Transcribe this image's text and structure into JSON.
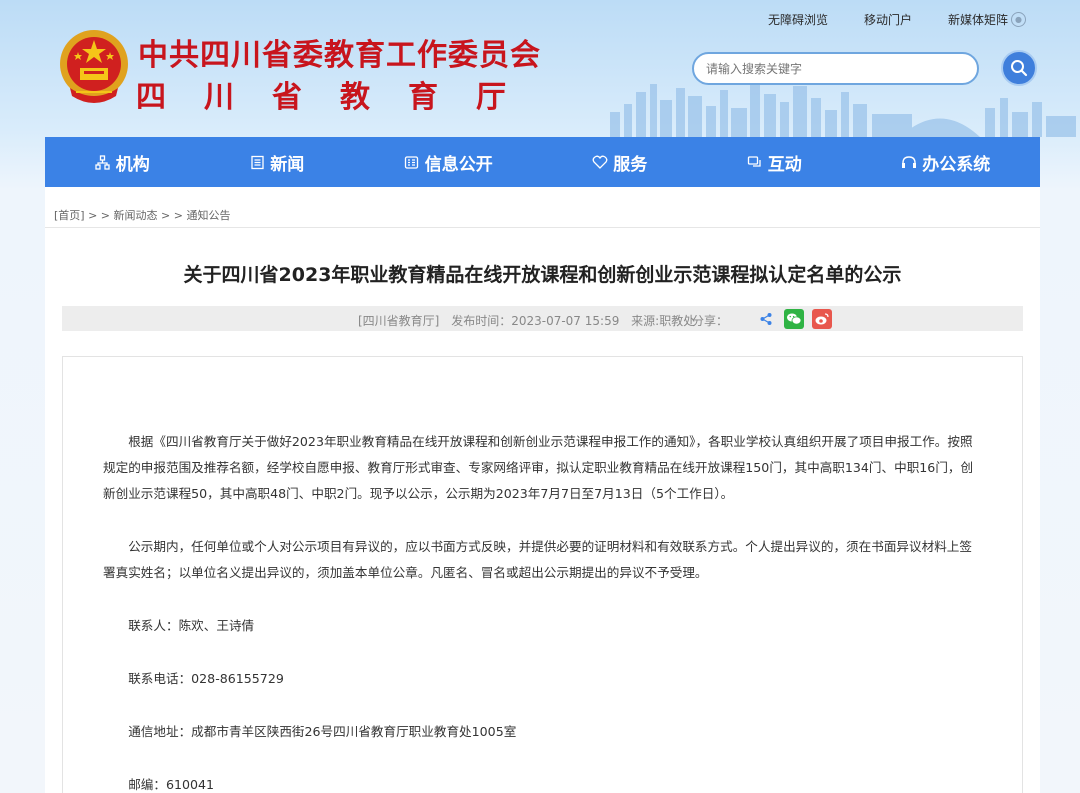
{
  "header": {
    "org_name": "中共四川省委教育工作委员会",
    "dept_chars": [
      "四",
      "川",
      "省",
      "教",
      "育",
      "厅"
    ],
    "top_links": [
      {
        "label": "无障碍浏览"
      },
      {
        "label": "移动门户"
      },
      {
        "label": "新媒体矩阵"
      }
    ],
    "search_placeholder": "请输入搜索关键字"
  },
  "nav": [
    {
      "label": "机构",
      "icon": "org-icon"
    },
    {
      "label": "新闻",
      "icon": "news-icon"
    },
    {
      "label": "信息公开",
      "icon": "info-icon"
    },
    {
      "label": "服务",
      "icon": "service-icon"
    },
    {
      "label": "互动",
      "icon": "interact-icon"
    },
    {
      "label": "办公系统",
      "icon": "office-icon"
    }
  ],
  "breadcrumb": {
    "home": "[首页]",
    "sep": "> >",
    "level1": "新闻动态",
    "level2": "通知公告"
  },
  "article": {
    "title": "关于四川省2023年职业教育精品在线开放课程和创新创业示范课程拟认定名单的公示",
    "meta": {
      "source_tag": "[四川省教育厅]",
      "publish_time": "发布时间：2023-07-07 15:59",
      "origin": "来源:职教处",
      "share_label": "分享："
    },
    "paragraphs": [
      "根据《四川省教育厅关于做好2023年职业教育精品在线开放课程和创新创业示范课程申报工作的通知》，各职业学校认真组织开展了项目申报工作。按照规定的申报范围及推荐名额，经学校自愿申报、教育厅形式审查、专家网络评审，拟认定职业教育精品在线开放课程150门，其中高职134门、中职16门，创新创业示范课程50，其中高职48门、中职2门。现予以公示，公示期为2023年7月7日至7月13日（5个工作日）。",
      "公示期内，任何单位或个人对公示项目有异议的，应以书面方式反映，并提供必要的证明材料和有效联系方式。个人提出异议的，须在书面异议材料上签署真实姓名；以单位名义提出异议的，须加盖本单位公章。凡匿名、冒名或超出公示期提出的异议不予受理。"
    ],
    "contacts": "联系人：陈欢、王诗倩",
    "phone": "联系电话：028-86155729",
    "address": "通信地址：成都市青羊区陕西街26号四川省教育厅职业教育处1005室",
    "postcode": "邮编：610041"
  },
  "colors": {
    "nav_bg": "#3b82e6",
    "brand_red": "#c8151d",
    "wechat": "#2fb344",
    "weibo": "#e8574d",
    "share": "#3b82e6"
  }
}
